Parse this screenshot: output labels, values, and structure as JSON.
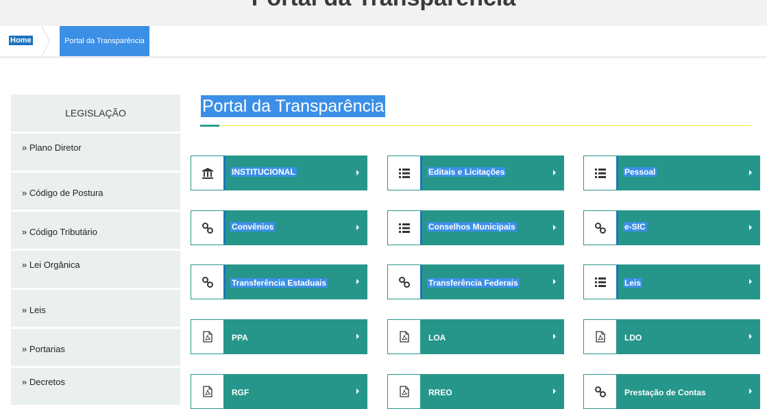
{
  "banner": {
    "title": "Portal da Transparência"
  },
  "breadcrumb": {
    "home": "Home",
    "current": "Portal da Transparência"
  },
  "page": {
    "title": "Portal da Transparência"
  },
  "sidebar": {
    "heading": "LEGISLAÇÃO",
    "items": [
      "» Plano Diretor",
      "» Código de Postura",
      "» Código Tributário",
      "» Lei Orgânica",
      "» Leis",
      "» Portarias",
      "» Decretos"
    ]
  },
  "tiles": [
    {
      "label": "INSTITUCIONAL",
      "icon": "bank-icon"
    },
    {
      "label": "Editais e Licitações",
      "icon": "list-icon"
    },
    {
      "label": "Pessoal",
      "icon": "list-icon"
    },
    {
      "label": "Convênios",
      "icon": "link-icon"
    },
    {
      "label": "Conselhos Municipais",
      "icon": "list-icon"
    },
    {
      "label": "e-SIC",
      "icon": "link-icon"
    },
    {
      "label": "Transferência Estaduais",
      "icon": "link-icon"
    },
    {
      "label": "Transferência Federais",
      "icon": "link-icon"
    },
    {
      "label": "Leis",
      "icon": "list-icon"
    },
    {
      "label": "PPA",
      "icon": "pdf-icon"
    },
    {
      "label": "LOA",
      "icon": "pdf-icon"
    },
    {
      "label": "LDO",
      "icon": "pdf-icon"
    },
    {
      "label": "RGF",
      "icon": "pdf-icon"
    },
    {
      "label": "RREO",
      "icon": "pdf-icon"
    },
    {
      "label": "Prestação de Contas",
      "icon": "link-icon"
    }
  ],
  "colors": {
    "tile": "#26968a",
    "highlight": "#3b8fe6",
    "sidebar": "#eaf0ee",
    "accent_line": "#f0e442"
  }
}
